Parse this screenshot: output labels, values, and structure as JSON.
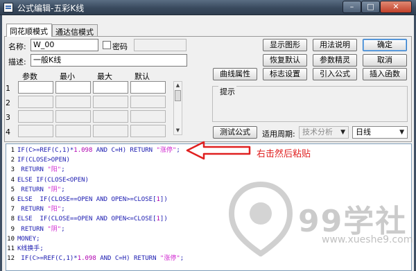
{
  "window": {
    "title": "公式编辑-五彩K线",
    "minimize": "–",
    "maximize": "□",
    "close": "✕"
  },
  "tabs": [
    {
      "label": "同花顺模式",
      "active": true
    },
    {
      "label": "通达信模式",
      "active": false
    }
  ],
  "form": {
    "name_label": "名称:",
    "name_value": "W_00",
    "password_label": "密码",
    "desc_label": "描述:",
    "desc_value": "一般K线"
  },
  "params": {
    "headers": [
      "参数",
      "最小",
      "最大",
      "默认"
    ],
    "rows": [
      "1",
      "2",
      "3",
      "4"
    ]
  },
  "buttons": {
    "show_graph": "显示图形",
    "usage": "用法说明",
    "ok": "确定",
    "restore_default": "恢复默认",
    "param_wizard": "参数精灵",
    "cancel": "取消",
    "curve_props": "曲线属性",
    "marker_settings": "标志设置",
    "import_formula": "引入公式",
    "insert_function": "插入函数",
    "test_formula": "测试公式"
  },
  "hint": {
    "label": "提示"
  },
  "period": {
    "label": "适用周期:",
    "type_value": "技术分析",
    "period_value": "日线"
  },
  "code_lines": [
    {
      "n": "1",
      "parts": [
        {
          "t": "IF(C>=REF(C,1)*"
        },
        {
          "t": "1.098",
          "c": "num"
        },
        {
          "t": " AND C=H) RETURN "
        },
        {
          "t": "\"涨停\"",
          "c": "str"
        },
        {
          "t": ";"
        }
      ]
    },
    {
      "n": "2",
      "parts": [
        {
          "t": "IF(CLOSE>OPEN)"
        }
      ]
    },
    {
      "n": "3",
      "parts": [
        {
          "t": " RETURN "
        },
        {
          "t": "\"阳\"",
          "c": "str"
        },
        {
          "t": ";"
        }
      ]
    },
    {
      "n": "4",
      "parts": [
        {
          "t": "ELSE IF(CLOSE<OPEN)"
        }
      ]
    },
    {
      "n": "5",
      "parts": [
        {
          "t": " RETURN "
        },
        {
          "t": "\"阴\"",
          "c": "str"
        },
        {
          "t": ";"
        }
      ]
    },
    {
      "n": "6",
      "parts": [
        {
          "t": "ELSE  IF(CLOSE==OPEN AND OPEN>=CLOSE["
        },
        {
          "t": "1",
          "c": "num"
        },
        {
          "t": "])"
        }
      ]
    },
    {
      "n": "7",
      "parts": [
        {
          "t": " RETURN "
        },
        {
          "t": "\"阳\"",
          "c": "str"
        },
        {
          "t": ";"
        }
      ]
    },
    {
      "n": "8",
      "parts": [
        {
          "t": "ELSE  IF(CLOSE==OPEN AND OPEN<=CLOSE["
        },
        {
          "t": "1",
          "c": "num"
        },
        {
          "t": "])"
        }
      ]
    },
    {
      "n": "9",
      "parts": [
        {
          "t": " RETURN "
        },
        {
          "t": "\"阴\"",
          "c": "str"
        },
        {
          "t": ";"
        }
      ]
    },
    {
      "n": "10",
      "parts": [
        {
          "t": "MONEY;"
        }
      ]
    },
    {
      "n": "11",
      "parts": [
        {
          "t": "K线换手;"
        }
      ]
    },
    {
      "n": "12",
      "parts": [
        {
          "t": " IF(C>=REF(C,1)*"
        },
        {
          "t": "1.098",
          "c": "num"
        },
        {
          "t": " AND C=H) RETURN "
        },
        {
          "t": "\"涨停\"",
          "c": "str"
        },
        {
          "t": ";"
        }
      ]
    }
  ],
  "annotation": {
    "text": "右击然后粘贴",
    "color": "#e02020"
  },
  "watermark": {
    "brand": "99学社",
    "url": "www.xueshe9.com"
  },
  "colors": {
    "keyword": "#1a1ab0",
    "string": "#d028d0",
    "titlebar": "#394a5e"
  }
}
